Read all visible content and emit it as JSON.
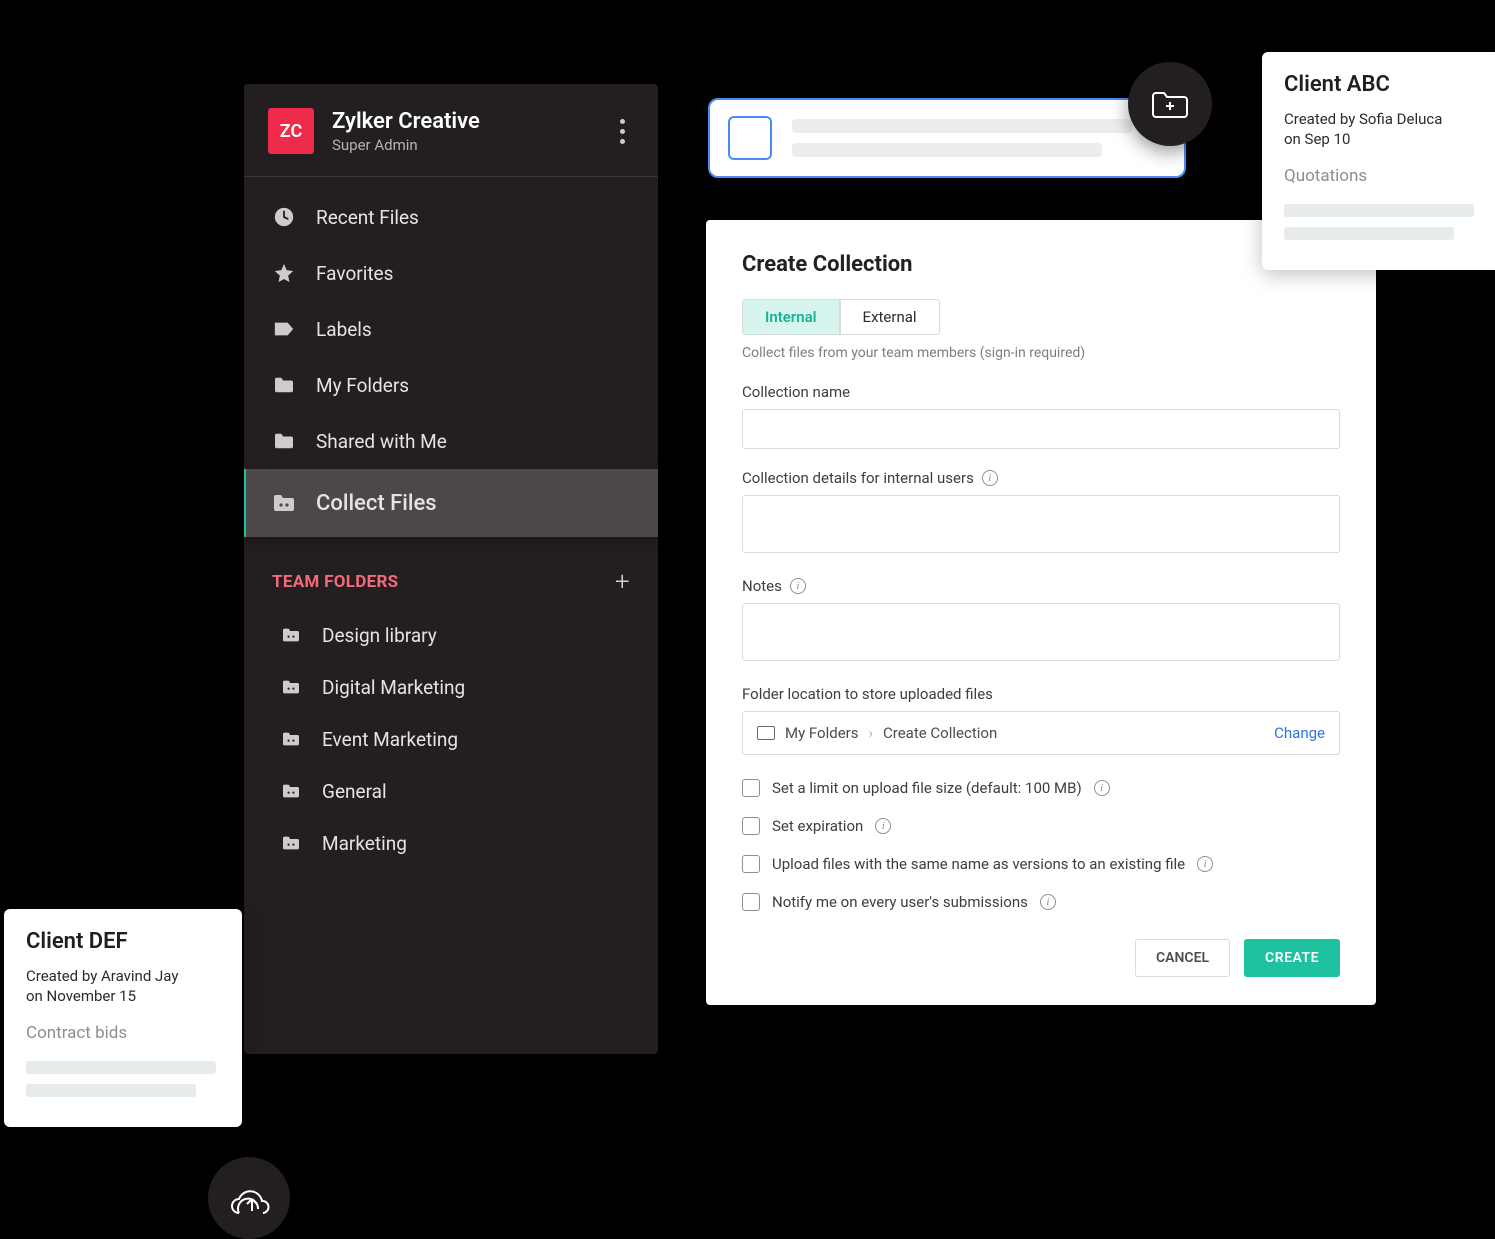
{
  "workspace": {
    "badge": "ZC",
    "name": "Zylker Creative",
    "role": "Super Admin"
  },
  "nav": {
    "recent": "Recent Files",
    "favorites": "Favorites",
    "labels": "Labels",
    "my_folders": "My Folders",
    "shared": "Shared with Me",
    "collect": "Collect Files"
  },
  "team_section": {
    "title": "TEAM FOLDERS",
    "items": [
      "Design library",
      "Digital Marketing",
      "Event Marketing",
      "General",
      "Marketing"
    ]
  },
  "dialog": {
    "title": "Create Collection",
    "tabs": {
      "internal": "Internal",
      "external": "External"
    },
    "hint": "Collect files from your team members (sign-in required)",
    "labels": {
      "name": "Collection name",
      "details": "Collection details for internal users",
      "notes": "Notes",
      "folder": "Folder location to store uploaded files"
    },
    "path": {
      "root": "My Folders",
      "leaf": "Create Collection",
      "change": "Change"
    },
    "options": {
      "limit": "Set a limit on upload file size (default: 100 MB)",
      "expire": "Set expiration",
      "versions": "Upload files with the same name as versions to an existing file",
      "notify": "Notify me on every user's submissions"
    },
    "buttons": {
      "cancel": "CANCEL",
      "create": "CREATE"
    }
  },
  "card_def": {
    "title": "Client DEF",
    "meta_line1": "Created by Aravind Jay",
    "meta_line2": "on November 15",
    "sub": "Contract bids"
  },
  "card_abc": {
    "title": "Client ABC",
    "meta_line1": "Created by Sofia Deluca",
    "meta_line2": "on Sep 10",
    "sub": "Quotations"
  }
}
